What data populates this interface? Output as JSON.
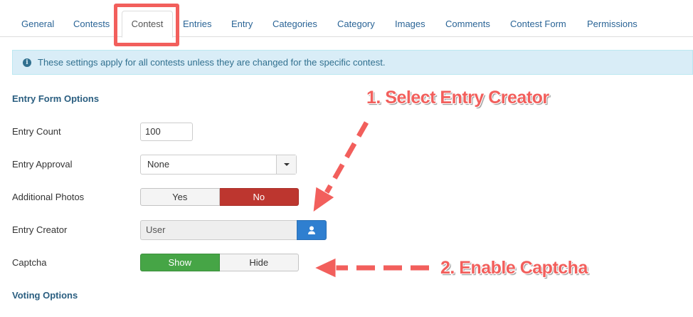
{
  "tabs": [
    {
      "label": "General"
    },
    {
      "label": "Contests"
    },
    {
      "label": "Contest",
      "active": true
    },
    {
      "label": "Entries"
    },
    {
      "label": "Entry"
    },
    {
      "label": "Categories"
    },
    {
      "label": "Category"
    },
    {
      "label": "Images"
    },
    {
      "label": "Comments"
    },
    {
      "label": "Contest Form"
    },
    {
      "label": "Permissions"
    }
  ],
  "alert": {
    "icon": "info-icon",
    "text": "These settings apply for all contests unless they are changed for the specific contest."
  },
  "entry_form": {
    "title": "Entry Form Options",
    "entry_count": {
      "label": "Entry Count",
      "value": "100"
    },
    "entry_approval": {
      "label": "Entry Approval",
      "selected": "None"
    },
    "additional_photos": {
      "label": "Additional Photos",
      "yes": "Yes",
      "no": "No",
      "selected": "No"
    },
    "entry_creator": {
      "label": "Entry Creator",
      "value": "User",
      "button_icon": "user-icon"
    },
    "captcha": {
      "label": "Captcha",
      "show": "Show",
      "hide": "Hide",
      "selected": "Show"
    }
  },
  "voting": {
    "title": "Voting Options"
  },
  "annotations": {
    "step1": "1. Select Entry Creator",
    "step2": "2. Enable Captcha",
    "color": "#f25f5c"
  },
  "colors": {
    "link": "#2a6496",
    "alert_bg": "#d9edf7",
    "toggle_red": "#bd362f",
    "toggle_green": "#46a546",
    "button_blue": "#2f7fd0"
  }
}
